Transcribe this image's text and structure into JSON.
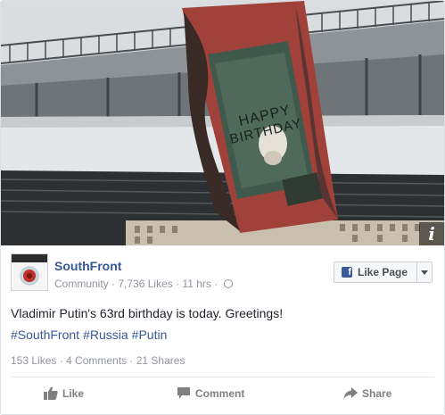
{
  "post": {
    "page_name": "SouthFront",
    "category": "Community",
    "likes_count": "7,736 Likes",
    "time": "11 hrs",
    "like_page_label": "Like Page",
    "text": "Vladimir Putin's 63rd birthday is today. Greetings!",
    "hashtags": [
      "#SouthFront",
      "#Russia",
      "#Putin"
    ],
    "stats": {
      "likes": "153 Likes",
      "comments": "4 Comments",
      "shares": "21 Shares"
    },
    "actions": {
      "like": "Like",
      "comment": "Comment",
      "share": "Share"
    }
  },
  "photo": {
    "banner_line1": "HAPPY",
    "banner_line2": "BIRTHDAY",
    "info_glyph": "i"
  },
  "avatar": {
    "lines": [
      "SOUTH FRONT",
      "ANALYSIS",
      "INTELLIGENCE"
    ]
  },
  "colors": {
    "link": "#365899",
    "muted": "#90949c",
    "fb_blue": "#3b5998",
    "banner_red": "#a0413a",
    "banner_green": "#3f5a4c"
  },
  "icons": {
    "like": "thumbs-up-icon",
    "comment": "speech-bubble-icon",
    "share": "share-arrow-icon",
    "privacy": "globe-icon",
    "info": "info-icon"
  }
}
